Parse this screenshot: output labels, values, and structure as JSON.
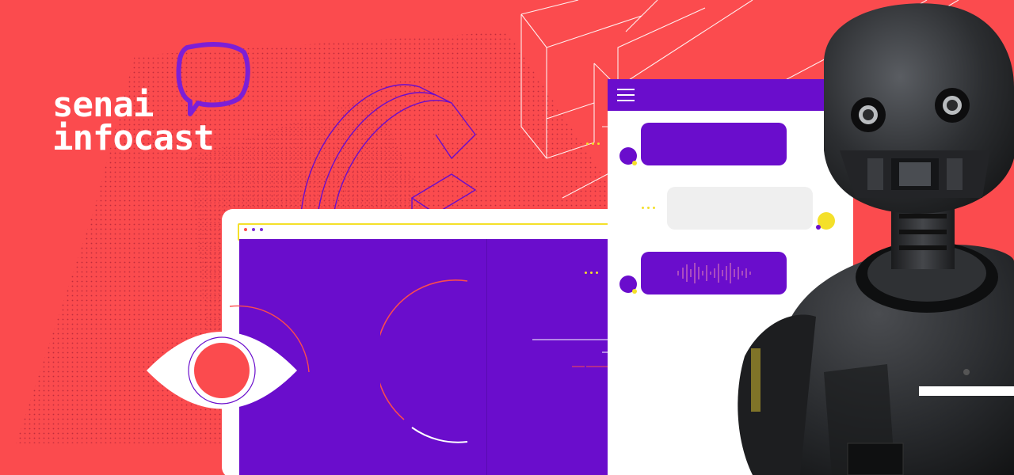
{
  "brand": {
    "line1": "senai",
    "line2": "infocast",
    "bubble_icon": "speech-bubble-icon",
    "colors": {
      "background": "#fb4b4e",
      "purple": "#6a0dcc",
      "yellow": "#f4e02a",
      "white": "#ffffff"
    }
  },
  "chat": {
    "menu_icon": "hamburger-menu-icon",
    "messages": [
      {
        "side": "left",
        "kind": "text",
        "color": "purple"
      },
      {
        "side": "right",
        "kind": "typing",
        "color": "grey"
      },
      {
        "side": "left",
        "kind": "audio",
        "color": "purple",
        "icon": "audio-waveform-icon"
      }
    ]
  },
  "illustration": {
    "eye_icon": "eye-icon",
    "phone_icon": "telephone-outline-icon",
    "robot": "robot-figure"
  }
}
